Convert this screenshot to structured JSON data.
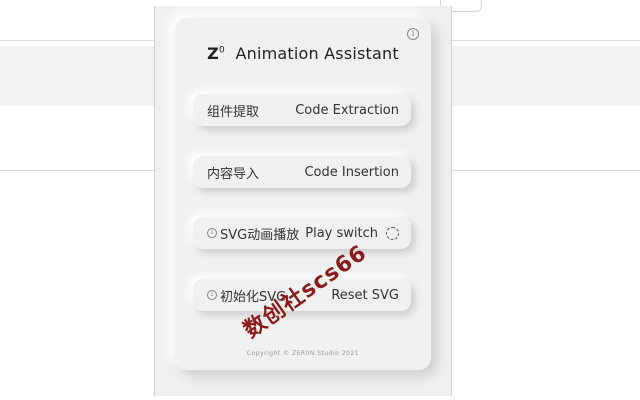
{
  "popup": {
    "title_prefix": "Z",
    "title_sup": "0",
    "title_main": "Animation Assistant",
    "info_icon": "info-icon",
    "buttons": [
      {
        "cn": "组件提取",
        "en": "Code Extraction",
        "info": false,
        "spinner": false
      },
      {
        "cn": "内容导入",
        "en": "Code Insertion",
        "info": false,
        "spinner": false
      },
      {
        "cn": "SVG动画播放",
        "en": "Play switch",
        "info": true,
        "spinner": true
      },
      {
        "cn": "初始化SVG",
        "en": "Reset SVG",
        "info": true,
        "spinner": false
      }
    ],
    "copyright": "Copyright © ZER0N Studio 2021"
  },
  "watermark": "数创社scs66",
  "colors": {
    "card_bg": "#f0f0f0",
    "watermark": "#8b1a1a"
  }
}
